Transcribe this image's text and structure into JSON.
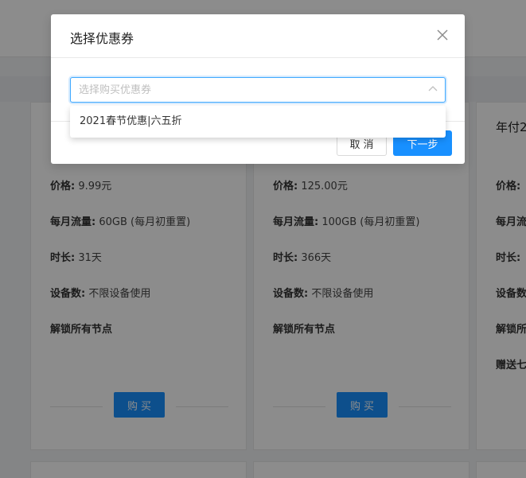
{
  "background": {
    "cards": [
      {
        "heading": "",
        "price_label": "价格:",
        "price": "9.99元",
        "traffic_label": "每月流量:",
        "traffic": "60GB (每月初重置)",
        "duration_label": "时长:",
        "duration": "31天",
        "devices_label": "设备数:",
        "devices": "不限设备使用",
        "unlock": "解锁所有节点",
        "extra": "",
        "buy_label": "购买"
      },
      {
        "heading": "",
        "price_label": "价格:",
        "price": "125.00元",
        "traffic_label": "每月流量:",
        "traffic": "100GB (每月初重置)",
        "duration_label": "时长:",
        "duration": "366天",
        "devices_label": "设备数:",
        "devices": "不限设备使用",
        "unlock": "解锁所有节点",
        "extra": "",
        "buy_label": "购买"
      },
      {
        "heading": "年付2",
        "price_label": "价格:",
        "traffic_label": "每月流",
        "duration_label": "时长:",
        "devices_label": "设备数",
        "unlock": "解锁所",
        "extra": "赠送七"
      }
    ]
  },
  "modal": {
    "title": "选择优惠券",
    "close_icon": "close-icon",
    "select": {
      "value": "",
      "placeholder": "选择购买优惠券",
      "arrow_icon": "chevron-up-icon"
    },
    "dropdown": {
      "options": [
        "2021春节优惠|六五折"
      ]
    },
    "cancel_label": "取消",
    "next_label": "下一步"
  },
  "colors": {
    "primary": "#1890ff",
    "focus_border": "#40a9ff",
    "mask": "rgba(0,0,0,0.45)"
  }
}
